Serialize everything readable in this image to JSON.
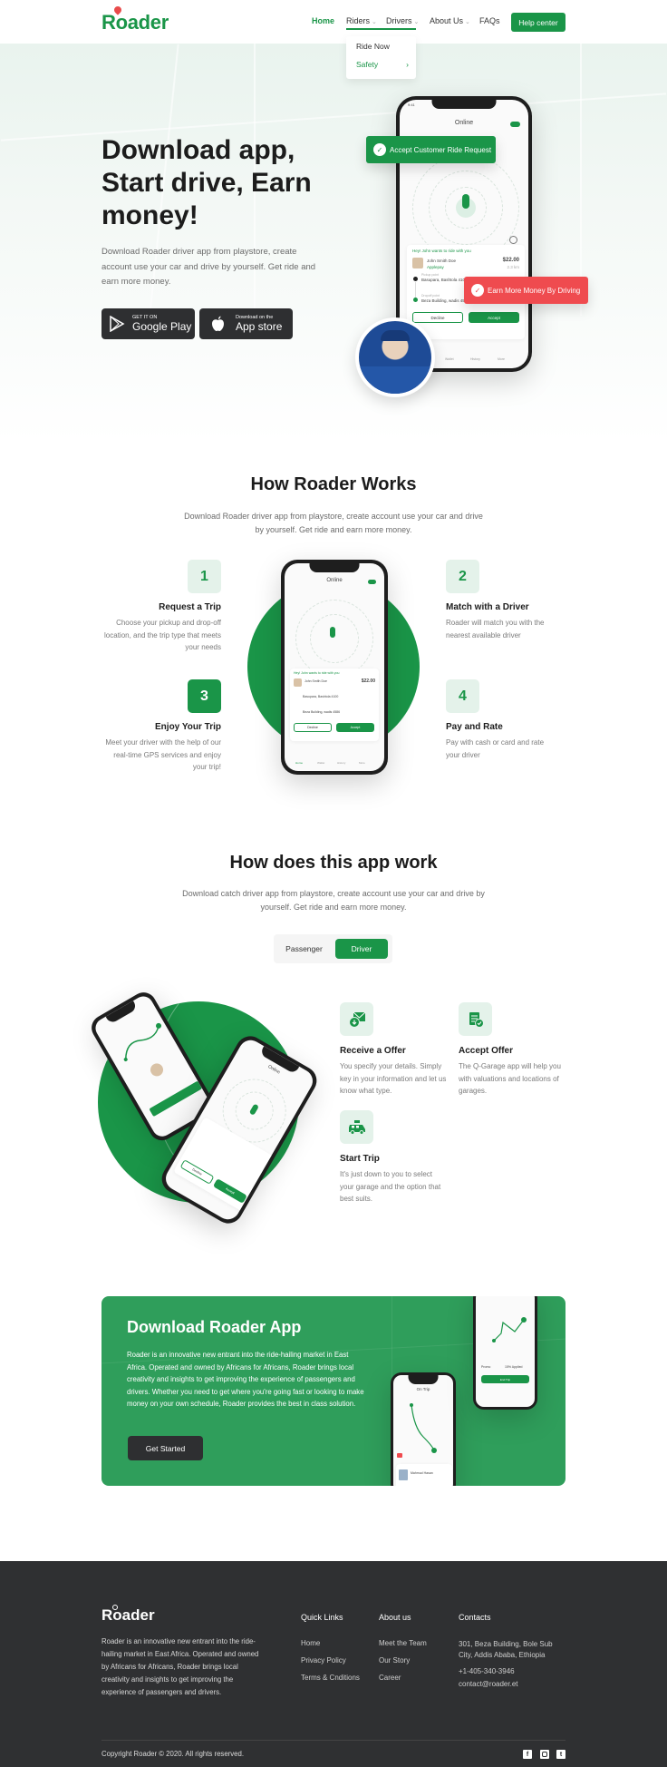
{
  "header": {
    "logo": "Roader",
    "nav": [
      {
        "label": "Home",
        "active": true
      },
      {
        "label": "Riders",
        "has_dropdown": true,
        "open": true
      },
      {
        "label": "Drivers",
        "has_dropdown": true
      },
      {
        "label": "About Us",
        "has_dropdown": true
      },
      {
        "label": "FAQs"
      }
    ],
    "help_button": "Help center",
    "dropdown": {
      "items": [
        {
          "label": "Ride Now"
        },
        {
          "label": "Safety",
          "highlighted": true,
          "icon": "chevron-right-icon"
        }
      ]
    }
  },
  "hero": {
    "title": "Download app, Start drive, Earn money!",
    "description": "Download Roader driver app from playstore, create account use your car and drive by yourself. Get ride and earn more money.",
    "google_play": {
      "small": "GET IT ON",
      "big": "Google Play"
    },
    "app_store": {
      "small": "Download on the",
      "big": "App store"
    },
    "badge_accept": "Accept Customer Ride Request",
    "badge_earn": "Earn More Money By Driving",
    "phone": {
      "time": "9:41",
      "status": "Online",
      "request_header": "Hey! John wants to ride with you",
      "rider_name": "John Smith Doe",
      "rider_tag": "Applepay",
      "price": "$22.00",
      "distance": "2.3 km",
      "pickup_label": "Pickup point",
      "pickup": "Basupara, Bashtola 4100",
      "dropoff_label": "Dropoff point",
      "dropoff": "Beza Building, wadis 4586",
      "decline": "Decline",
      "accept": "Accept",
      "tabs": [
        "Home",
        "Wallet",
        "History",
        "More"
      ]
    }
  },
  "how_works": {
    "title": "How Roader Works",
    "description": "Download Roader driver app from playstore, create account use your car and drive by yourself. Get ride and earn more money.",
    "steps": [
      {
        "number": "1",
        "title": "Request a Trip",
        "description": "Choose your pickup and drop-off location, and the trip type that meets your needs"
      },
      {
        "number": "2",
        "title": "Match with a Driver",
        "description": "Roader will match you with the nearest available driver"
      },
      {
        "number": "3",
        "title": "Enjoy Your Trip",
        "description": "Meet your driver with the help of our real-time GPS services and enjoy your trip!"
      },
      {
        "number": "4",
        "title": "Pay and Rate",
        "description": "Pay with cash or card and rate your driver"
      }
    ]
  },
  "app_work": {
    "title": "How does this app work",
    "description": "Download catch driver app from playstore, create account use your car and drive by yourself. Get ride and earn more money.",
    "tabs": [
      {
        "label": "Passenger",
        "active": false
      },
      {
        "label": "Driver",
        "active": true
      }
    ],
    "features": [
      {
        "icon": "mail-download-icon",
        "title": "Receive a Offer",
        "description": "You specify your details. Simply key in your information and let us know what type."
      },
      {
        "icon": "document-check-icon",
        "title": "Accept Offer",
        "description": "The Q-Garage app will help you with valuations and locations of garages."
      },
      {
        "icon": "taxi-icon",
        "title": "Start Trip",
        "description": "It's just down to you to select your garage and the option that best suits."
      }
    ]
  },
  "download": {
    "title": "Download Roader App",
    "description": "Roader is an innovative new entrant into the ride-hailing market in East Africa. Operated and owned by Africans for Africans, Roader brings local creativity and insights to get improving the experience of passengers and drivers. Whether you need to get where you're going fast or looking to make money on your own schedule, Roader provides the best in class solution.",
    "button": "Get Started",
    "phone_a": {
      "title": "On Trip",
      "driver": "Mahmud Hasan"
    },
    "phone_b": {
      "payment": "Promo",
      "discount": "15% Applied",
      "button": "End Trip"
    }
  },
  "footer": {
    "logo": "Roader",
    "description": "Roader is an innovative new entrant into the ride-hailing market in East Africa. Operated and owned by Africans for Africans, Roader brings local creativity and insights to get improving the experience of passengers and drivers.",
    "quick_links": {
      "heading": "Quick Links",
      "items": [
        "Home",
        "Privacy Policy",
        "Terms & Cnditions"
      ]
    },
    "about": {
      "heading": "About us",
      "items": [
        "Meet the Team",
        "Our Story",
        "Career"
      ]
    },
    "contacts": {
      "heading": "Contacts",
      "address": "301, Beza Building, Bole Sub City, Addis Ababa, Ethiopia",
      "phone": "+1-405-340-3946",
      "email": "contact@roader.et"
    },
    "copyright": "Copyright Roader © 2020. All rights reserved.",
    "social": [
      "facebook-icon",
      "instagram-icon",
      "twitter-icon"
    ]
  },
  "colors": {
    "brand": "#1a9548",
    "banner": "#2f9e5b",
    "alert": "#ef4b4f",
    "footer": "#2f3032"
  }
}
